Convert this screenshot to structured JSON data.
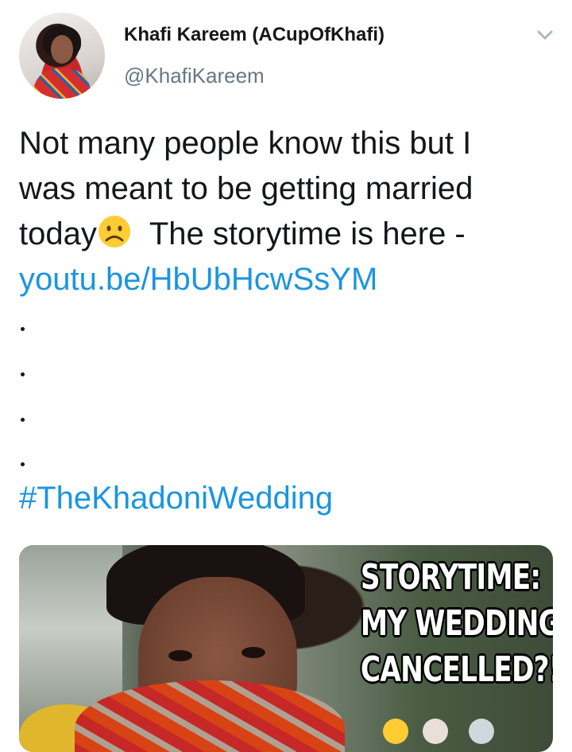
{
  "tweet": {
    "author": {
      "display_name": "Khafi Kareem (ACupOfKhafi)",
      "handle": "@KhafiKareem"
    },
    "text_lines": [
      "Not many people know this but I",
      "was meant to be getting married",
      "today"
    ],
    "text_after_emoji": "The storytime is here -",
    "link": "youtu.be/HbUbHcwSsYM",
    "hashtag": "#TheKhadoniWedding",
    "emoji": "sad-face-emoji",
    "media": {
      "overlay_lines": [
        "STORYTIME:",
        "MY WEDDING",
        "CANCELLED?!"
      ]
    }
  },
  "colors": {
    "link": "#1b95e0",
    "text": "#14171a",
    "secondary": "#657786"
  }
}
